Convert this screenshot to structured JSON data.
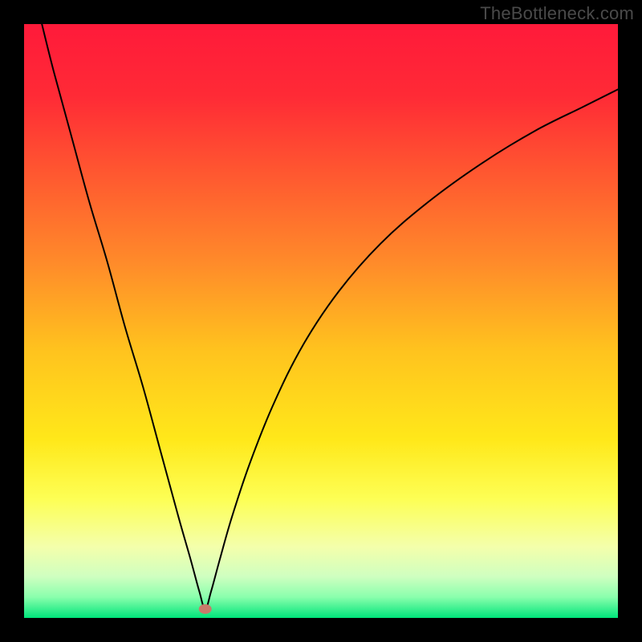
{
  "watermark": "TheBottleneck.com",
  "chart_data": {
    "type": "line",
    "title": "",
    "xlabel": "",
    "ylabel": "",
    "xlim": [
      0,
      100
    ],
    "ylim": [
      0,
      100
    ],
    "grid": false,
    "background": {
      "gradient_stops": [
        {
          "offset": 0.0,
          "color": "#ff1a3a"
        },
        {
          "offset": 0.12,
          "color": "#ff2a36"
        },
        {
          "offset": 0.25,
          "color": "#ff5730"
        },
        {
          "offset": 0.4,
          "color": "#ff8a2a"
        },
        {
          "offset": 0.55,
          "color": "#ffc31e"
        },
        {
          "offset": 0.7,
          "color": "#ffe81a"
        },
        {
          "offset": 0.8,
          "color": "#fdff55"
        },
        {
          "offset": 0.88,
          "color": "#f4ffab"
        },
        {
          "offset": 0.93,
          "color": "#cfffc0"
        },
        {
          "offset": 0.965,
          "color": "#8affad"
        },
        {
          "offset": 1.0,
          "color": "#00e57a"
        }
      ]
    },
    "marker": {
      "x": 30.5,
      "y": 1.5,
      "rx": 8,
      "ry": 6,
      "color": "#c97a6a"
    },
    "series": [
      {
        "name": "curve",
        "color": "#000000",
        "stroke_width": 2,
        "x": [
          3,
          5,
          8,
          11,
          14,
          17,
          20,
          23,
          26,
          28,
          29.5,
          30.5,
          31.5,
          33,
          35,
          38,
          42,
          47,
          53,
          60,
          68,
          77,
          86,
          94,
          100
        ],
        "y": [
          100,
          92,
          81,
          70,
          60,
          49,
          39,
          28,
          17,
          10,
          4.5,
          1.5,
          4.5,
          10,
          17,
          26,
          36,
          46,
          55,
          63,
          70,
          76.5,
          82,
          86,
          89
        ]
      }
    ]
  }
}
